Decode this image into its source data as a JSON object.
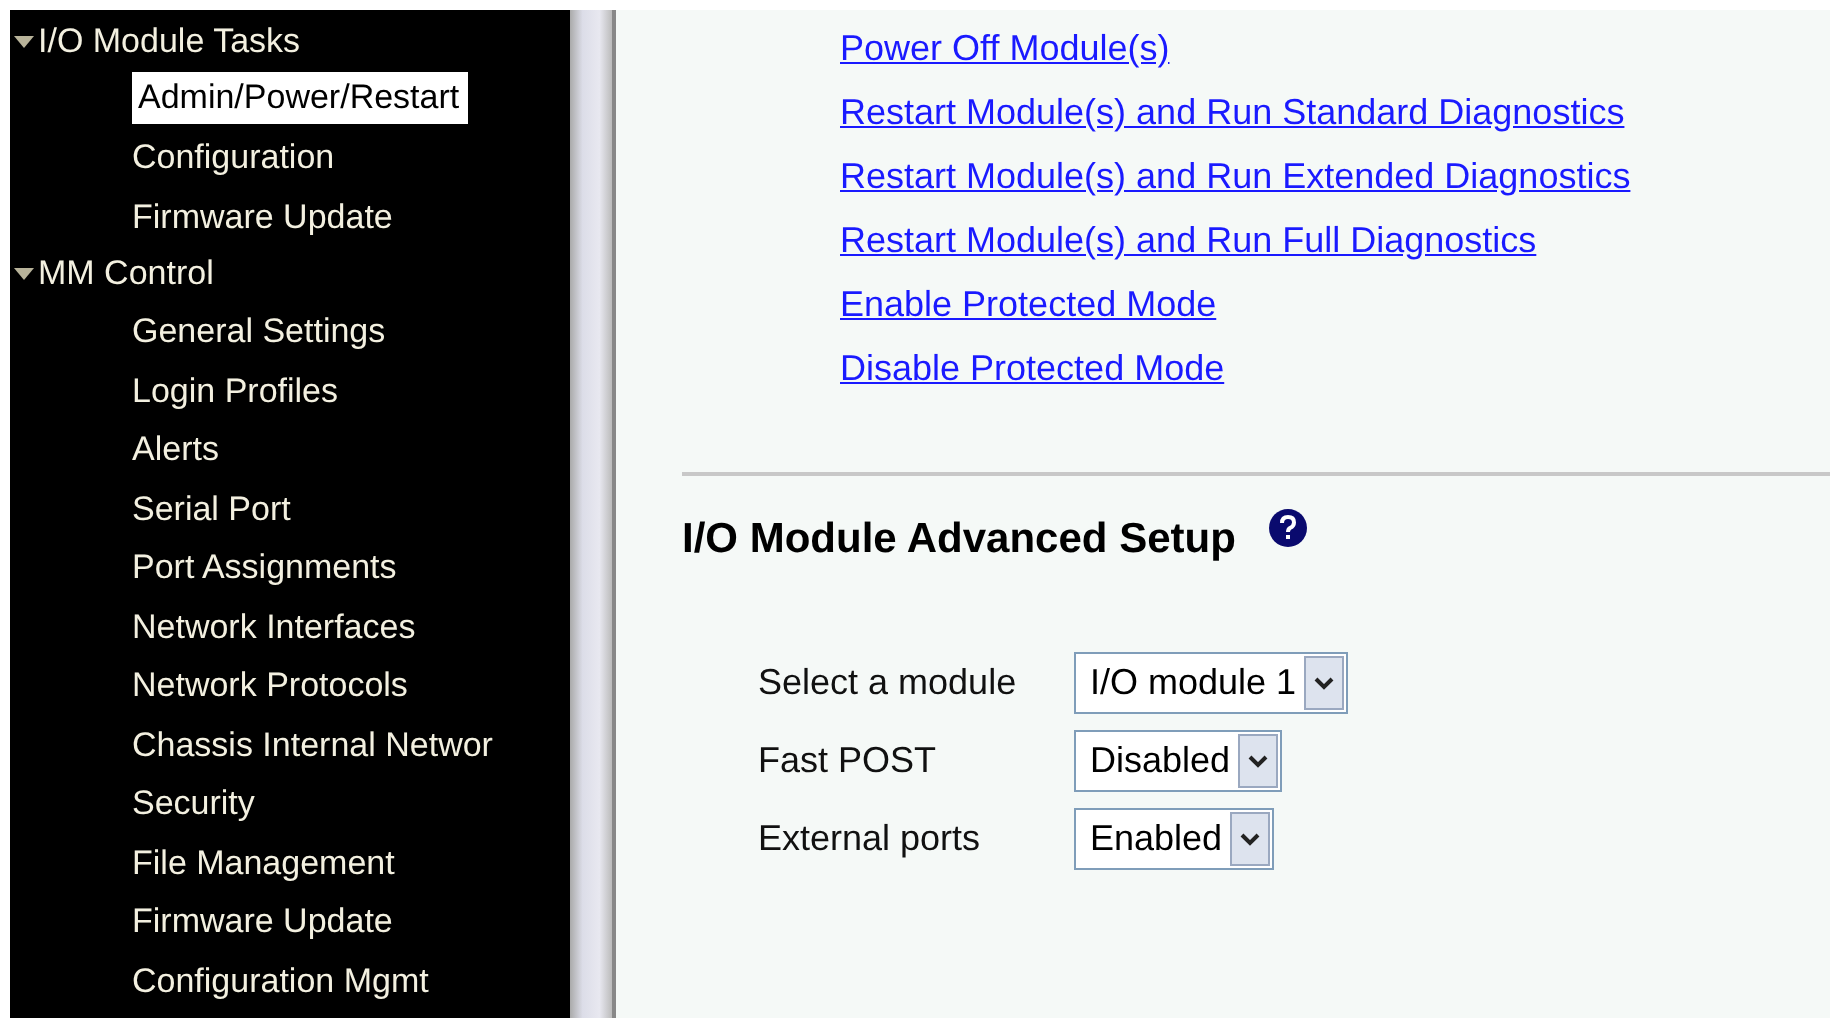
{
  "sidebar": {
    "groups": [
      {
        "label": "I/O Module Tasks",
        "expanded": true,
        "children": [
          {
            "label": "Admin/Power/Restart",
            "selected": true
          },
          {
            "label": "Configuration",
            "selected": false
          },
          {
            "label": "Firmware Update",
            "selected": false
          }
        ]
      },
      {
        "label": "MM Control",
        "expanded": true,
        "children": [
          {
            "label": "General Settings",
            "selected": false
          },
          {
            "label": "Login Profiles",
            "selected": false
          },
          {
            "label": "Alerts",
            "selected": false
          },
          {
            "label": "Serial Port",
            "selected": false
          },
          {
            "label": "Port Assignments",
            "selected": false
          },
          {
            "label": "Network Interfaces",
            "selected": false
          },
          {
            "label": "Network Protocols",
            "selected": false
          },
          {
            "label": "Chassis Internal Networ",
            "selected": false
          },
          {
            "label": "Security",
            "selected": false
          },
          {
            "label": "File Management",
            "selected": false
          },
          {
            "label": "Firmware Update",
            "selected": false
          },
          {
            "label": "Configuration Mgmt",
            "selected": false
          }
        ]
      }
    ]
  },
  "links": [
    "Power Off Module(s)",
    "Restart Module(s) and Run Standard Diagnostics",
    "Restart Module(s) and Run Extended Diagnostics",
    "Restart Module(s) and Run Full Diagnostics",
    "Enable Protected Mode",
    "Disable Protected Mode"
  ],
  "advanced_setup": {
    "title": "I/O Module Advanced Setup",
    "fields": [
      {
        "label": "Select a module",
        "value": "I/O module 1"
      },
      {
        "label": "Fast POST",
        "value": "Disabled"
      },
      {
        "label": "External ports",
        "value": "Enabled"
      }
    ]
  }
}
